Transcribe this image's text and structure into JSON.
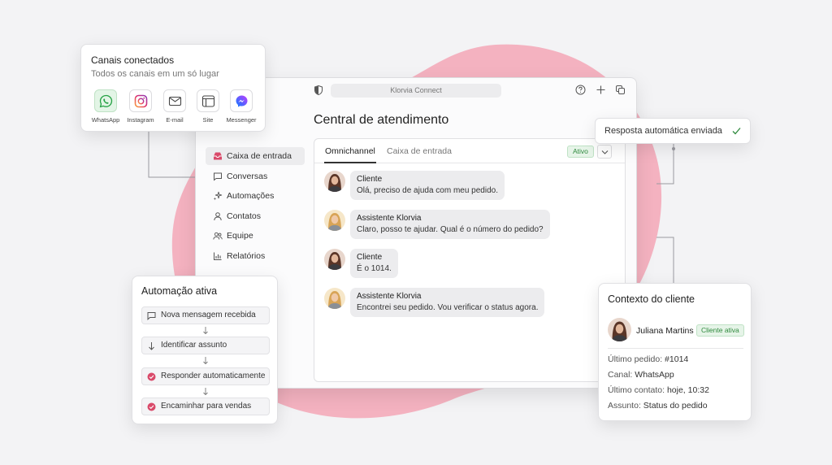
{
  "colors": {
    "accent_pink": "#f4a9b8",
    "active_icon": "#d94a6a",
    "success_green": "#2f8a3e",
    "whatsapp_green": "#25a244"
  },
  "window": {
    "url": "Klorvia Connect",
    "title": "Central de atendimento",
    "toolbar_icons": [
      "shield-icon",
      "help-icon",
      "plus-icon",
      "copy-icon"
    ]
  },
  "sidebar": {
    "items": [
      {
        "label": "Caixa de entrada",
        "icon": "inbox-icon",
        "active": true
      },
      {
        "label": "Conversas",
        "icon": "chat-icon"
      },
      {
        "label": "Automações",
        "icon": "sparkle-icon"
      },
      {
        "label": "Contatos",
        "icon": "user-icon"
      },
      {
        "label": "Equipe",
        "icon": "users-icon"
      },
      {
        "label": "Relatórios",
        "icon": "chart-icon"
      }
    ]
  },
  "chat": {
    "tabs": [
      "Omnichannel",
      "Caixa de entrada"
    ],
    "status": "Ativo",
    "messages": [
      {
        "author": "Cliente",
        "text": "Olá, preciso de ajuda com meu pedido."
      },
      {
        "author": "Assistente Klorvia",
        "text": "Claro, posso te ajudar. Qual é o número do pedido?"
      },
      {
        "author": "Cliente",
        "text": "É o 1014."
      },
      {
        "author": "Assistente Klorvia",
        "text": "Encontrei seu pedido. Vou verificar o status agora."
      }
    ]
  },
  "canais": {
    "title": "Canais conectados",
    "subtitle": "Todos os canais em um só lugar",
    "items": [
      {
        "label": "WhatsApp",
        "icon": "whatsapp-icon"
      },
      {
        "label": "Instagram",
        "icon": "instagram-icon"
      },
      {
        "label": "E-mail",
        "icon": "mail-icon"
      },
      {
        "label": "Site",
        "icon": "browser-icon"
      },
      {
        "label": "Messenger",
        "icon": "messenger-icon"
      }
    ]
  },
  "resposta": {
    "label": "Resposta automática enviada"
  },
  "automacao": {
    "title": "Automação ativa",
    "steps": [
      "Nova mensagem recebida",
      "Identificar assunto",
      "Responder automaticamente",
      "Encaminhar para vendas"
    ]
  },
  "contexto": {
    "title": "Contexto do cliente",
    "name": "Juliana Martins",
    "badge": "Cliente ativa",
    "fields": [
      {
        "key": "Último pedido:",
        "value": "#1014"
      },
      {
        "key": "Canal:",
        "value": "WhatsApp"
      },
      {
        "key": "Último contato:",
        "value": "hoje, 10:32"
      },
      {
        "key": "Assunto:",
        "value": "Status do pedido"
      }
    ]
  }
}
